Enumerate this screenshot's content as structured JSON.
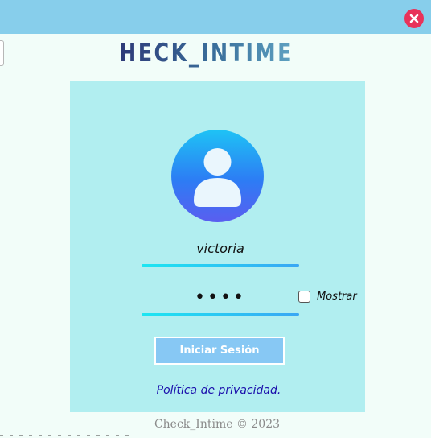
{
  "logo": {
    "text": "HECK_INTIME",
    "icon": "alarm-clock-icon"
  },
  "close_icon": "close-icon",
  "user": {
    "icon": "user-avatar-icon",
    "username": "victoria"
  },
  "password": {
    "masked": "••••"
  },
  "show_password": {
    "label": "Mostrar",
    "checked": false
  },
  "login_button": {
    "label": "Iniciar Sesión"
  },
  "privacy_link": {
    "label": "Política de privacidad."
  },
  "footer": {
    "text": "Check_Intime © 2023"
  },
  "colors": {
    "titlebar": "#87ceeb",
    "background": "#f2fdf9",
    "card": "#b1eef0",
    "close": "#e8335a",
    "button": "#87c8f4",
    "link": "#1a0dab"
  }
}
